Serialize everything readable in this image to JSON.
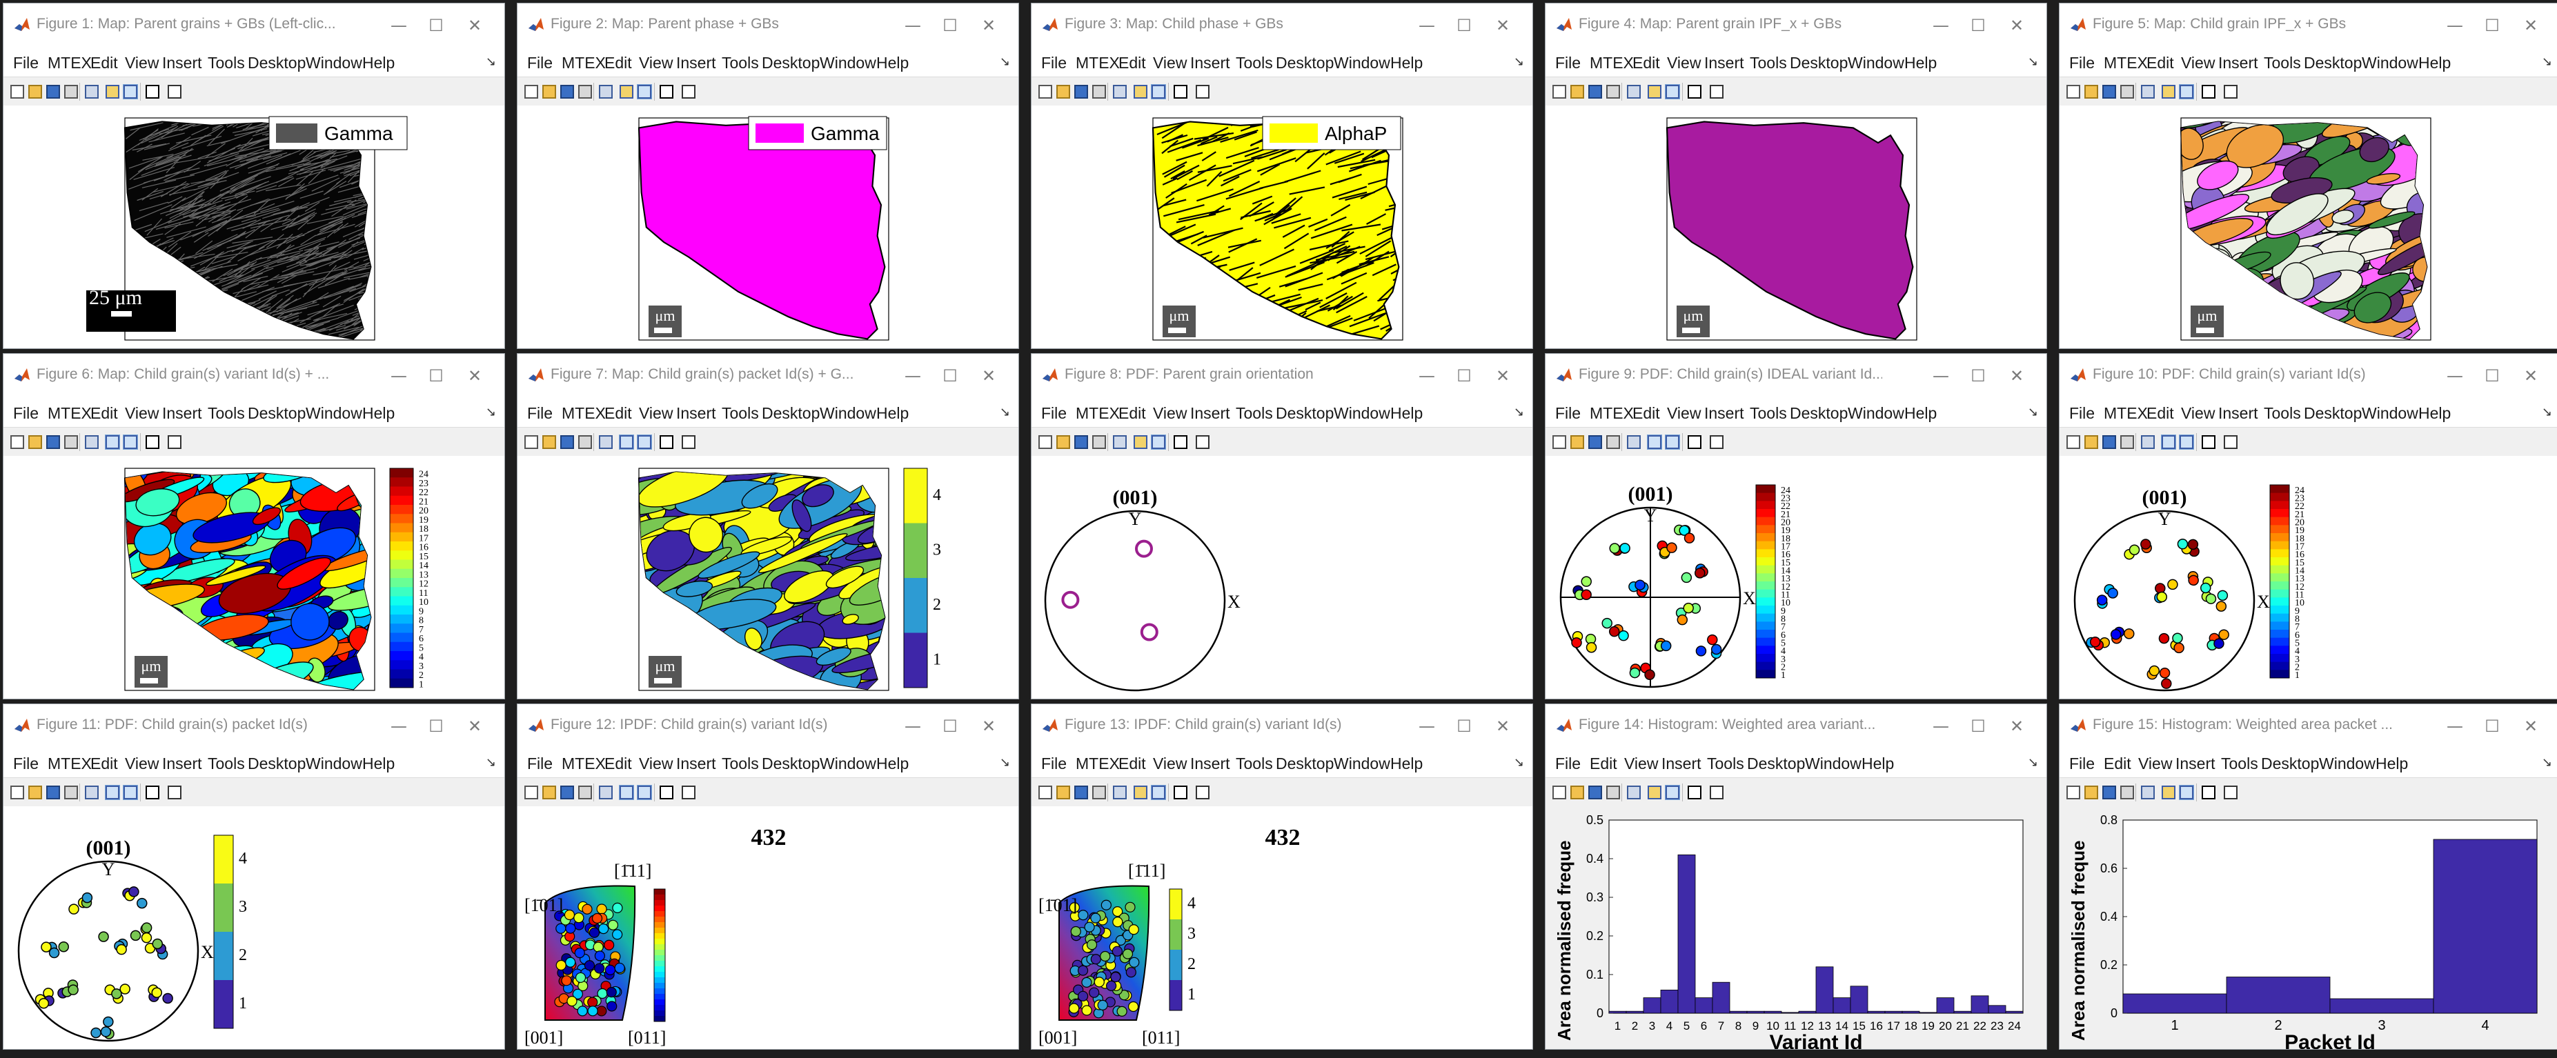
{
  "menu_common": [
    "File",
    "MTEX",
    "Edit",
    "View",
    "Insert",
    "Tools",
    "Desktop",
    "Window",
    "Help"
  ],
  "menu_plain": [
    "File",
    "Edit",
    "View",
    "Insert",
    "Tools",
    "Desktop",
    "Window",
    "Help"
  ],
  "dock_glyph": "↘",
  "window_controls": {
    "minimize": "—",
    "maximize": "☐",
    "close": "✕"
  },
  "colors": {
    "matlab_logo": "#d95319",
    "gamma": "#ff00ff",
    "alphap": "#ffff00",
    "parent_ipf": "#a81ba0",
    "bar": "#3f2ba8"
  },
  "figures": [
    {
      "title": "Figure 1: Map: Parent grains + GBs (Left-clic...",
      "legend": "Gamma",
      "scale": "25 μm"
    },
    {
      "title": "Figure 2: Map: Parent phase + GBs",
      "legend": "Gamma",
      "scale": "μm"
    },
    {
      "title": "Figure 3: Map: Child phase + GBs",
      "legend": "AlphaP",
      "scale": "μm"
    },
    {
      "title": "Figure 4: Map: Parent grain IPF_x + GBs",
      "scale": "μm"
    },
    {
      "title": "Figure 5: Map: Child grain IPF_x + GBs",
      "scale": "μm"
    },
    {
      "title": "Figure 6: Map: Child grain(s) variant Id(s) + ...",
      "scale": "μm",
      "colorbar_ticks": [
        "24",
        "23",
        "22",
        "21",
        "20",
        "19",
        "18",
        "17",
        "16",
        "15",
        "14",
        "13",
        "12",
        "11",
        "10",
        "9",
        "8",
        "7",
        "6",
        "5",
        "4",
        "3",
        "2",
        "1"
      ]
    },
    {
      "title": "Figure 7: Map: Child grain(s) packet Id(s) + G...",
      "scale": "μm",
      "colorbar_ticks": [
        "4",
        "3",
        "2",
        "1"
      ]
    },
    {
      "title": "Figure 8: PDF: Parent grain orientation",
      "pole": "(001)",
      "axis_y": "Y",
      "axis_x": "X"
    },
    {
      "title": "Figure 9: PDF: Child grain(s) IDEAL variant Id...",
      "pole": "(001)",
      "axis_y": "Y",
      "axis_x": "X",
      "colorbar_ticks": [
        "24",
        "23",
        "22",
        "21",
        "20",
        "19",
        "18",
        "17",
        "16",
        "15",
        "14",
        "13",
        "12",
        "11",
        "10",
        "9",
        "8",
        "7",
        "6",
        "5",
        "4",
        "3",
        "2",
        "1"
      ]
    },
    {
      "title": "Figure 10: PDF: Child grain(s) variant Id(s)",
      "pole": "(001)",
      "axis_y": "Y",
      "axis_x": "X",
      "colorbar_ticks": [
        "24",
        "23",
        "22",
        "21",
        "20",
        "19",
        "18",
        "17",
        "16",
        "15",
        "14",
        "13",
        "12",
        "11",
        "10",
        "9",
        "8",
        "7",
        "6",
        "5",
        "4",
        "3",
        "2",
        "1"
      ]
    },
    {
      "title": "Figure 11: PDF: Child grain(s) packet Id(s)",
      "pole": "(001)",
      "axis_y": "Y",
      "axis_x": "X",
      "colorbar_ticks": [
        "4",
        "3",
        "2",
        "1"
      ]
    },
    {
      "title": "Figure 12: IPDF: Child grain(s) variant Id(s)",
      "sym": "432",
      "c101": "[1̄01]",
      "c111": "[1̄11]",
      "c001": "[001]",
      "c011": "[011]"
    },
    {
      "title": "Figure 13: IPDF: Child grain(s) variant Id(s)",
      "sym": "432",
      "c101": "[1̄01]",
      "c111": "[1̄11]",
      "c001": "[001]",
      "c011": "[011]",
      "colorbar_ticks": [
        "4",
        "3",
        "2",
        "1"
      ]
    },
    {
      "title": "Figure 14: Histogram: Weighted area variant...",
      "xlabel": "Variant Id",
      "ylabel": "Area normalised freque"
    },
    {
      "title": "Figure 15: Histogram: Weighted area packet ...",
      "xlabel": "Packet Id",
      "ylabel": "Area normalised freque"
    }
  ],
  "chart_data": [
    {
      "type": "bar",
      "title": "",
      "xlabel": "Variant Id",
      "ylabel": "Area normalised freque",
      "categories": [
        "1",
        "2",
        "3",
        "4",
        "5",
        "6",
        "7",
        "8",
        "9",
        "10",
        "11",
        "12",
        "13",
        "14",
        "15",
        "16",
        "17",
        "18",
        "19",
        "20",
        "21",
        "22",
        "23",
        "24"
      ],
      "values": [
        0.005,
        0.005,
        0.04,
        0.06,
        0.41,
        0.04,
        0.08,
        0.005,
        0.005,
        0.005,
        0.002,
        0.005,
        0.12,
        0.04,
        0.07,
        0.005,
        0.005,
        0.005,
        0.002,
        0.04,
        0.005,
        0.045,
        0.02,
        0.005
      ],
      "ylim": [
        0,
        0.5
      ],
      "yticks": [
        "0",
        "0.1",
        "0.2",
        "0.3",
        "0.4",
        "0.5"
      ]
    },
    {
      "type": "bar",
      "title": "",
      "xlabel": "Packet Id",
      "ylabel": "Area normalised freque",
      "categories": [
        "1",
        "2",
        "3",
        "4"
      ],
      "values": [
        0.08,
        0.15,
        0.06,
        0.72
      ],
      "ylim": [
        0,
        0.8
      ],
      "yticks": [
        "0",
        "0.2",
        "0.4",
        "0.6",
        "0.8"
      ]
    }
  ]
}
